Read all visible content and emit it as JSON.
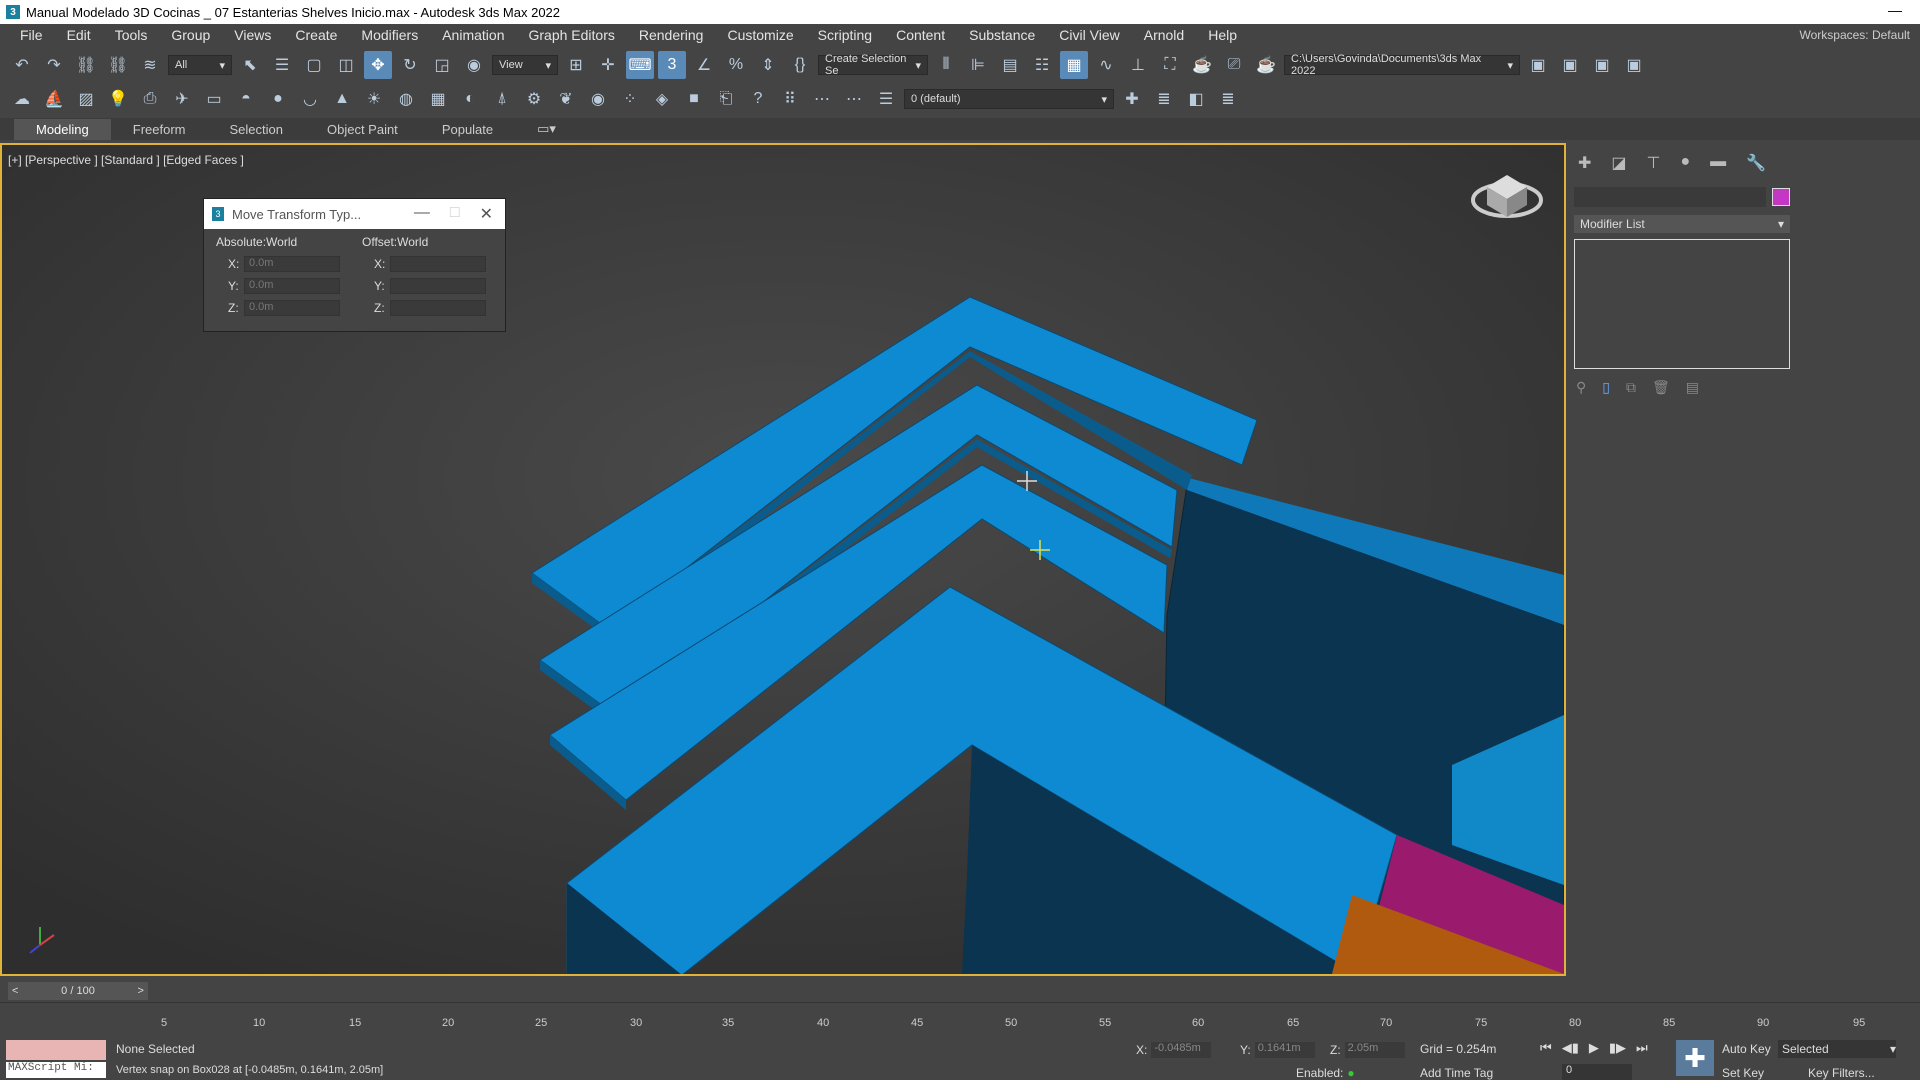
{
  "window": {
    "title": "Manual Modelado 3D Cocinas _ 07 Estanterias Shelves Inicio.max - Autodesk 3ds Max 2022",
    "app_icon_letter": "3"
  },
  "menu": {
    "items": [
      "File",
      "Edit",
      "Tools",
      "Group",
      "Views",
      "Create",
      "Modifiers",
      "Animation",
      "Graph Editors",
      "Rendering",
      "Customize",
      "Scripting",
      "Content",
      "Substance",
      "Civil View",
      "Arnold",
      "Help"
    ],
    "workspace_label": "Workspaces:",
    "workspace_value": "Default"
  },
  "toolbar": {
    "selection_filter": "All",
    "ref_coord": "View",
    "named_selection": "Create Selection Se",
    "project_path": "C:\\Users\\Govinda\\Documents\\3ds Max 2022",
    "layer": "0 (default)"
  },
  "ribbon_tabs": [
    "Modeling",
    "Freeform",
    "Selection",
    "Object Paint",
    "Populate"
  ],
  "viewport": {
    "label": "[+] [Perspective ] [Standard ] [Edged Faces ]"
  },
  "transform_dialog": {
    "title": "Move Transform Typ...",
    "absolute_header": "Absolute:World",
    "offset_header": "Offset:World",
    "absolute": [
      {
        "axis": "X:",
        "value": "0.0m"
      },
      {
        "axis": "Y:",
        "value": "0.0m"
      },
      {
        "axis": "Z:",
        "value": "0.0m"
      }
    ],
    "offset": [
      {
        "axis": "X:",
        "value": ""
      },
      {
        "axis": "Y:",
        "value": ""
      },
      {
        "axis": "Z:",
        "value": ""
      }
    ]
  },
  "command_panel": {
    "modifier_list": "Modifier List",
    "color_swatch": "#c436c4"
  },
  "timeline": {
    "frame_display": "0 / 100",
    "ticks": [
      "5",
      "10",
      "15",
      "20",
      "25",
      "30",
      "35",
      "40",
      "45",
      "50",
      "55",
      "60",
      "65",
      "70",
      "75",
      "80",
      "85",
      "90",
      "95"
    ]
  },
  "status": {
    "selection": "None Selected",
    "prompt": "Vertex snap on Box028 at [-0.0485m, 0.1641m, 2.05m]",
    "maxscript": "MAXScript Mi:",
    "x_label": "X:",
    "x_value": "-0.0485m",
    "y_label": "Y:",
    "y_value": "0.1641m",
    "z_label": "Z:",
    "z_value": "2.05m",
    "grid": "Grid = 0.254m",
    "auto_key": "Auto Key",
    "set_key": "Set Key",
    "selected": "Selected",
    "frame": "0",
    "key_filters": "Key Filters...",
    "enabled": "Enabled:",
    "add_time_tag": "Add Time Tag"
  }
}
